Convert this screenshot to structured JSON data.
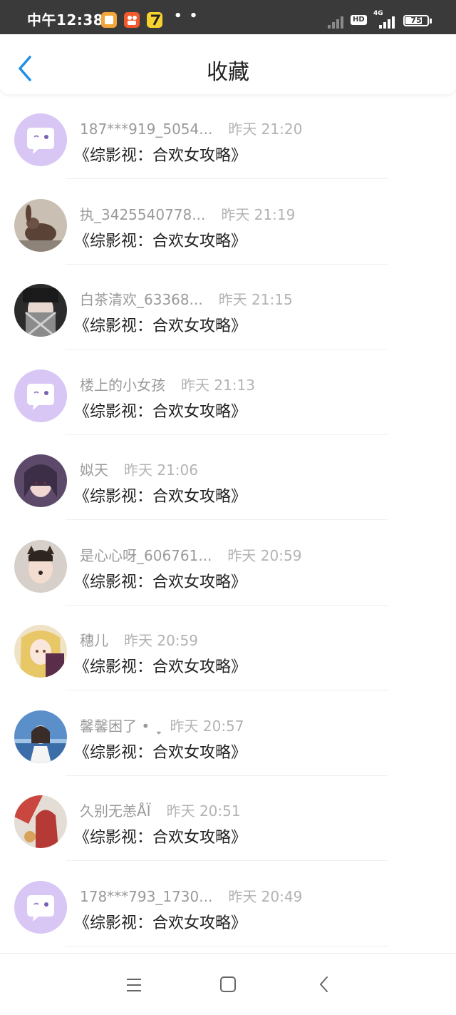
{
  "status_bar": {
    "time": "中午12:38",
    "dots": "• •",
    "network": "4G",
    "hd": "HD",
    "battery": "75",
    "battery_level": 0.75
  },
  "header": {
    "back_icon": "chevron-left-icon",
    "title": "收藏",
    "accent_color": "#1e8fe8"
  },
  "items": [
    {
      "user": "187***919_5054...",
      "time": "昨天 21:20",
      "title": "《综影视：合欢女攻略》",
      "avatar": "default-chat-avatar"
    },
    {
      "user": "执_3425540778...",
      "time": "昨天 21:19",
      "title": "《综影视：合欢女攻略》",
      "avatar": "rabbit-photo-avatar"
    },
    {
      "user": "白茶清欢_63368...",
      "time": "昨天 21:15",
      "title": "《综影视：合欢女攻略》",
      "avatar": "masked-girl-avatar"
    },
    {
      "user": "楼上的小女孩",
      "time": "昨天 21:13",
      "title": "《综影视：合欢女攻略》",
      "avatar": "default-chat-avatar"
    },
    {
      "user": "姒天",
      "time": "昨天 21:06",
      "title": "《综影视：合欢女攻略》",
      "avatar": "illustrated-girl-avatar"
    },
    {
      "user": "是心心呀_606761...",
      "time": "昨天 20:59",
      "title": "《综影视：合欢女攻略》",
      "avatar": "cat-filter-girl-avatar"
    },
    {
      "user": "穗儿",
      "time": "昨天 20:59",
      "title": "《综影视：合欢女攻略》",
      "avatar": "anime-girl-avatar"
    },
    {
      "user": "馨馨困了 • ִֶָ",
      "time": "昨天 20:57",
      "title": "《综影视：合欢女攻略》",
      "avatar": "seaside-girl-avatar"
    },
    {
      "user": "久别无恙ÅÏ",
      "time": "昨天 20:51",
      "title": "《综影视：合欢女攻略》",
      "avatar": "red-art-avatar"
    },
    {
      "user": "178***793_1730...",
      "time": "昨天 20:49",
      "title": "《综影视：合欢女攻略》",
      "avatar": "default-chat-avatar"
    }
  ],
  "nav_bar": {
    "menu_icon": "menu-icon",
    "home_icon": "home-square-icon",
    "back_icon": "back-triangle-icon"
  }
}
